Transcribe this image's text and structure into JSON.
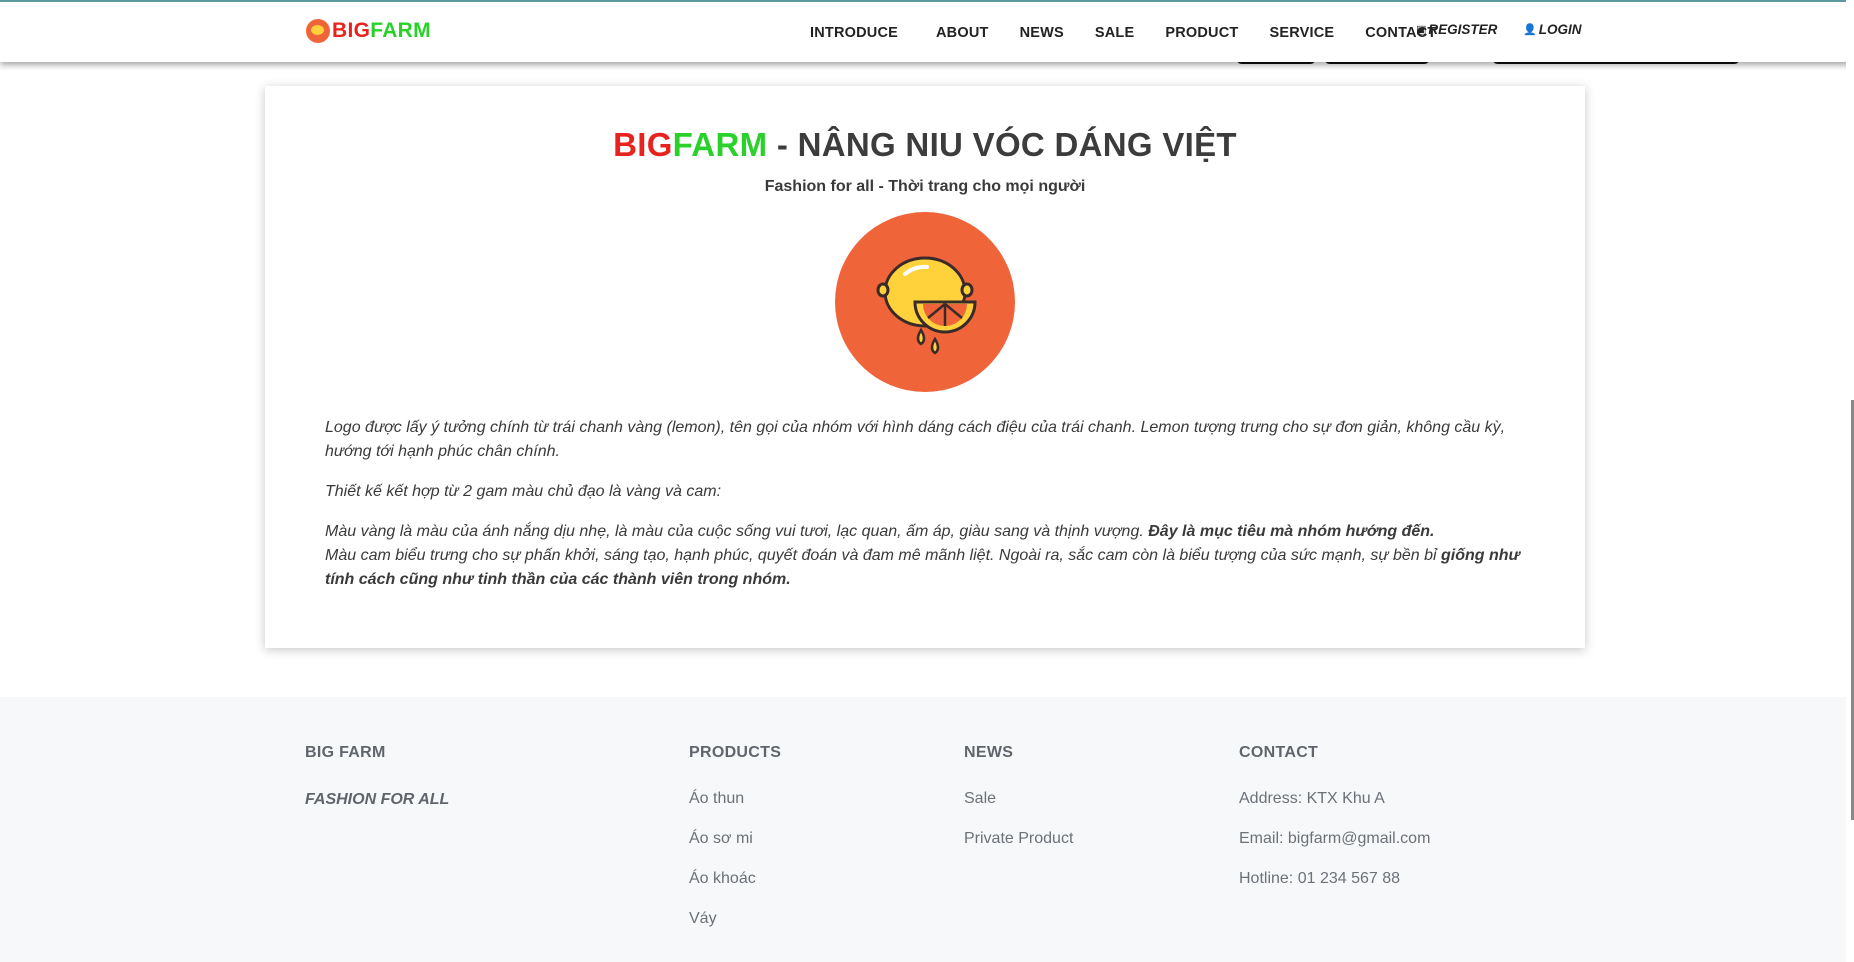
{
  "header": {
    "brand_big": "BIG",
    "brand_farm": "FARM",
    "nav": [
      "INTRODUCE",
      "ABOUT",
      "NEWS",
      "SALE",
      "PRODUCT",
      "SERVICE",
      "CONTACT"
    ],
    "register_label": "REGISTER",
    "login_label": "LOGIN",
    "register_icon": "id-card-icon",
    "login_icon": "user-icon"
  },
  "main": {
    "title_big": "BIG",
    "title_farm": "FARM",
    "title_rest": " - NÂNG NIU VÓC DÁNG VIỆT",
    "subtitle": "Fashion for all - Thời trang cho mọi người",
    "logo_icon": "lemon-logo-icon",
    "para1": "Logo được lấy ý tưởng chính từ trái chanh vàng (lemon), tên gọi của nhóm với hình dáng cách điệu của trái chanh. Lemon tượng trưng cho sự đơn giản, không cầu kỳ, hướng tới hạnh phúc chân chính.",
    "para2": "Thiết kế kết hợp từ 2 gam màu chủ đạo là vàng và cam:",
    "para3_text": "Màu vàng là màu của ánh nắng dịu nhẹ, là màu của cuộc sống vui tươi, lạc quan, ấm áp, giàu sang và thịnh vượng. ",
    "para3_bold": "Đây là mục tiêu mà nhóm hướng đến.",
    "para4_text": "Màu cam biểu trưng cho sự phấn khởi, sáng tạo, hạnh phúc, quyết đoán và đam mê mãnh liệt. Ngoài ra, sắc cam còn là biểu tượng của sức mạnh, sự bền bỉ ",
    "para4_bold": "giống như tính cách cũng như tinh thần của các thành viên trong nhóm."
  },
  "footer": {
    "brand_head": "BIG FARM",
    "brand_slogan": "FASHION FOR ALL",
    "products_head": "PRODUCTS",
    "products": [
      "Áo thun",
      "Áo sơ mi",
      "Áo khoác",
      "Váy"
    ],
    "news_head": "NEWS",
    "news": [
      "Sale",
      "Private Product"
    ],
    "contact_head": "CONTACT",
    "contact": [
      "Address: KTX Khu A",
      "Email: bigfarm@gmail.com",
      "Hotline: 01 234 567 88"
    ]
  },
  "colors": {
    "brand_red": "#e8231f",
    "brand_green": "#2bd12b",
    "logo_orange": "#f0643a",
    "logo_yellow": "#ffd23c"
  }
}
